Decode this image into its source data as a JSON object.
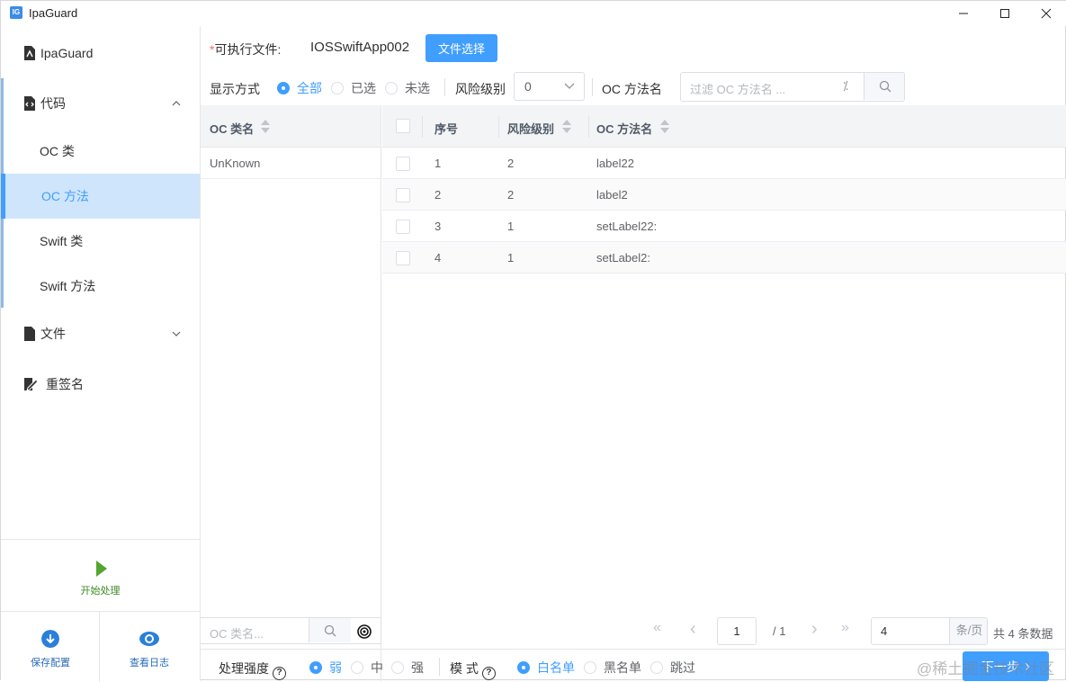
{
  "window": {
    "title": "IpaGuard",
    "app_icon_text": "IG",
    "minimize": "—",
    "maximize": "☐",
    "close": "✕"
  },
  "sidebar": {
    "items": [
      {
        "label": "IpaGuard",
        "icon": "document-icon"
      },
      {
        "label": "代码",
        "icon": "code-file-icon",
        "expanded": true
      },
      {
        "label": "OC 类"
      },
      {
        "label": "OC 方法",
        "active": true
      },
      {
        "label": "Swift 类"
      },
      {
        "label": "Swift 方法"
      },
      {
        "label": "文件",
        "icon": "file-icon",
        "expanded": false
      },
      {
        "label": "重签名",
        "icon": "sign-icon"
      }
    ],
    "start_label": "开始处理",
    "save_config_label": "保存配置",
    "view_log_label": "查看日志"
  },
  "toolbar": {
    "required_mark": "*",
    "exec_label": "可执行文件:",
    "exec_value": "IOSSwiftApp002",
    "choose_file_label": "文件选择",
    "display_label": "显示方式",
    "display_options": [
      "全部",
      "已选",
      "未选"
    ],
    "display_selected": "全部",
    "risk_label": "风险级别",
    "risk_value": "0",
    "method_label": "OC 方法名",
    "method_placeholder": "过滤 OC 方法名 ...",
    "clear_glyph": "⁒"
  },
  "class_table": {
    "header": "OC 类名",
    "rows": [
      "UnKnown"
    ],
    "search_placeholder": "OC 类名..."
  },
  "method_table": {
    "headers": [
      "序号",
      "风险级别",
      "OC 方法名"
    ],
    "rows": [
      {
        "index": "1",
        "risk": "2",
        "name": "label22"
      },
      {
        "index": "2",
        "risk": "2",
        "name": "label2"
      },
      {
        "index": "3",
        "risk": "1",
        "name": "setLabel22:"
      },
      {
        "index": "4",
        "risk": "1",
        "name": "setLabel2:"
      }
    ]
  },
  "pagination": {
    "first": "«",
    "prev": "‹",
    "next": "›",
    "last": "»",
    "current_page": "1",
    "total_pages": "/ 1",
    "page_size": "4",
    "page_size_unit": "条/页",
    "total_text": "共 4 条数据"
  },
  "footer": {
    "strength_label": "处理强度",
    "strength_options": [
      "弱",
      "中",
      "强"
    ],
    "strength_selected": "弱",
    "mode_label": "模 式",
    "mode_options": [
      "白名单",
      "黑名单",
      "跳过"
    ],
    "mode_selected": "白名单",
    "next_label": "下一步",
    "next_glyph": "›",
    "help_glyph": "?"
  },
  "watermark": "@稀土掘金技术社区",
  "colors": {
    "accent": "#409eff",
    "active_bg": "#cfe5fb",
    "start_green": "#52a52e",
    "blue_dark": "#2a7fd9"
  }
}
